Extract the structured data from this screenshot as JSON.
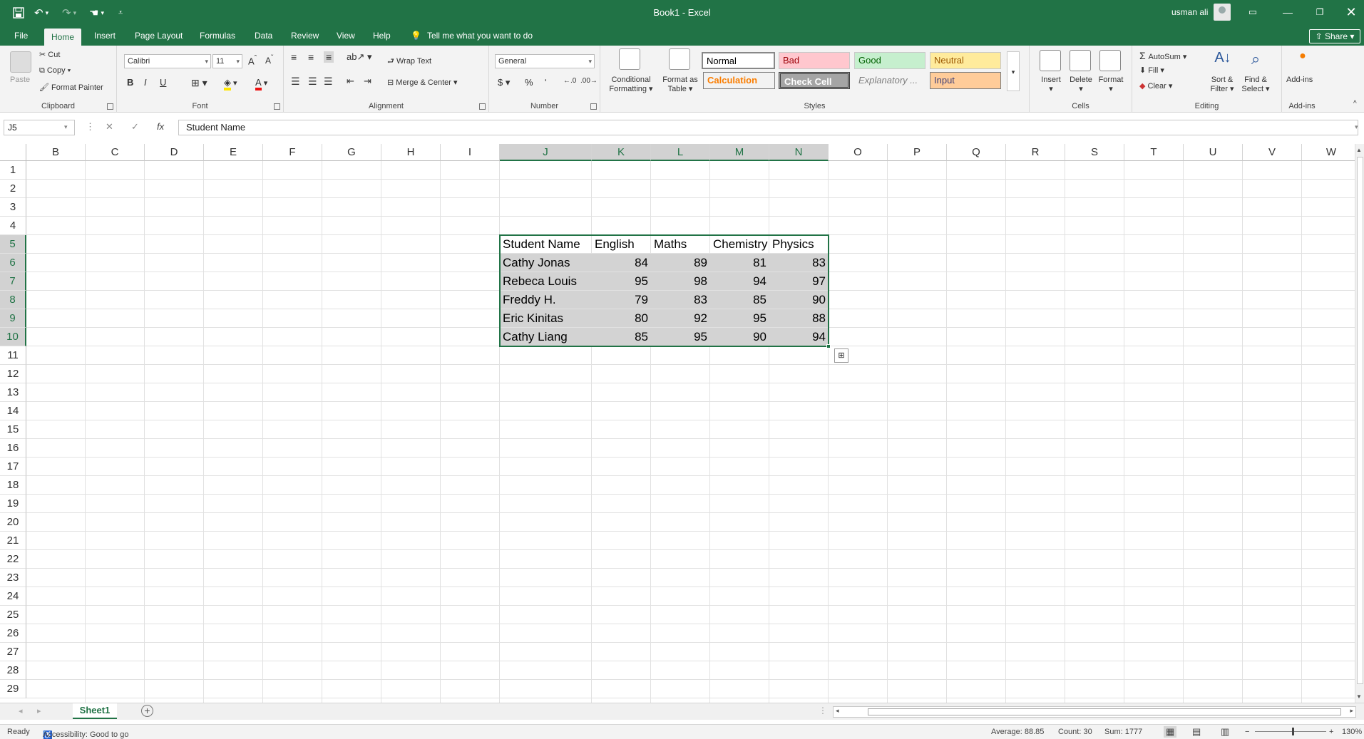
{
  "window": {
    "title": "Book1  -  Excel",
    "user": "usman ali"
  },
  "tabs": [
    "File",
    "Home",
    "Insert",
    "Page Layout",
    "Formulas",
    "Data",
    "Review",
    "View",
    "Help"
  ],
  "tell_me": "Tell me what you want to do",
  "share_label": "Share",
  "ribbon": {
    "clipboard": {
      "paste": "Paste",
      "cut": "Cut",
      "copy": "Copy",
      "format_painter": "Format Painter",
      "label": "Clipboard"
    },
    "font": {
      "name": "Calibri",
      "size": "11",
      "bold": "B",
      "italic": "I",
      "underline": "U",
      "label": "Font"
    },
    "alignment": {
      "wrap": "Wrap Text",
      "merge": "Merge & Center",
      "label": "Alignment"
    },
    "number": {
      "format": "General",
      "currency": "$",
      "percent": "%",
      "comma": "ⁱ",
      "label": "Number"
    },
    "styles": {
      "conditional": "Conditional",
      "conditional2": "Formatting",
      "format_as": "Format as",
      "format_as2": "Table",
      "normal": "Normal",
      "bad": "Bad",
      "good": "Good",
      "neutral": "Neutral",
      "calculation": "Calculation",
      "check_cell": "Check Cell",
      "explanatory": "Explanatory ...",
      "input": "Input",
      "label": "Styles"
    },
    "cells": {
      "insert": "Insert",
      "delete": "Delete",
      "format": "Format",
      "label": "Cells"
    },
    "editing": {
      "autosum": "AutoSum",
      "fill": "Fill",
      "clear": "Clear",
      "sort": "Sort &",
      "sort2": "Filter",
      "find": "Find &",
      "find2": "Select",
      "label": "Editing"
    },
    "addins": {
      "addins": "Add-ins",
      "label": "Add-ins"
    }
  },
  "formula_bar": {
    "name_box": "J5",
    "content": "Student Name"
  },
  "columns": [
    "B",
    "C",
    "D",
    "E",
    "F",
    "G",
    "H",
    "I",
    "J",
    "K",
    "L",
    "M",
    "N",
    "O",
    "P",
    "Q",
    "R",
    "S",
    "T",
    "U",
    "V",
    "W"
  ],
  "rows": [
    "1",
    "2",
    "3",
    "4",
    "5",
    "6",
    "7",
    "8",
    "9",
    "10",
    "11",
    "12",
    "13",
    "14",
    "15",
    "16",
    "17",
    "18",
    "19",
    "20",
    "21",
    "22",
    "23",
    "24",
    "25",
    "26",
    "27",
    "28",
    "29"
  ],
  "table": {
    "headers": [
      "Student Name",
      "English",
      "Maths",
      "Chemistry",
      "Physics"
    ],
    "rows": [
      [
        "Cathy Jonas",
        "84",
        "89",
        "81",
        "83"
      ],
      [
        "Rebeca Louis",
        "95",
        "98",
        "94",
        "97"
      ],
      [
        "Freddy H.",
        "79",
        "83",
        "85",
        "90"
      ],
      [
        "Eric Kinitas",
        "80",
        "92",
        "95",
        "88"
      ],
      [
        "Cathy Liang",
        "85",
        "95",
        "90",
        "94"
      ]
    ]
  },
  "sheet_tab": "Sheet1",
  "status": {
    "ready": "Ready",
    "accessibility": "Accessibility: Good to go",
    "average": "Average: 88.85",
    "count": "Count: 30",
    "sum": "Sum: 1777",
    "zoom": "130%"
  }
}
